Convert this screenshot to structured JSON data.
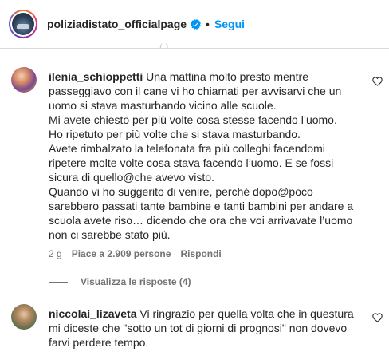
{
  "header": {
    "username": "poliziadistato_officialpage",
    "separator": "•",
    "follow_label": "Segui",
    "clipped_text": "(  ) "
  },
  "comments": [
    {
      "username": "ilenia_schioppetti",
      "text": "Una mattina molto presto mentre passeggiavo con il cane vi ho chiamati per avvisarvi che un uomo si stava masturbando vicino alle scuole.\nMi avete chiesto per più volte cosa stesse facendo l’uomo.\nHo ripetuto per più volte che si stava masturbando.\nAvete rimbalzato la telefonata fra più colleghi facendomi ripetere molte volte cosa stava facendo l’uomo. E se fossi sicura di quello@che avevo visto.\nQuando vi ho suggerito di venire, perché dopo@poco sarebbero passati tante bambine e tanti bambini per andare a scuola avete riso… dicendo che ora che voi arrivavate l’uomo non ci sarebbe stato più.",
      "time": "2 g",
      "likes": "Piace a 2.909 persone",
      "reply_label": "Rispondi",
      "view_replies": "Visualizza le risposte (4)"
    },
    {
      "username": "niccolai_lizaveta",
      "text": "Vi ringrazio per quella volta che in questura mi diceste che \"sotto un tot di giorni di prognosi\" non dovevo farvi perdere tempo."
    }
  ]
}
